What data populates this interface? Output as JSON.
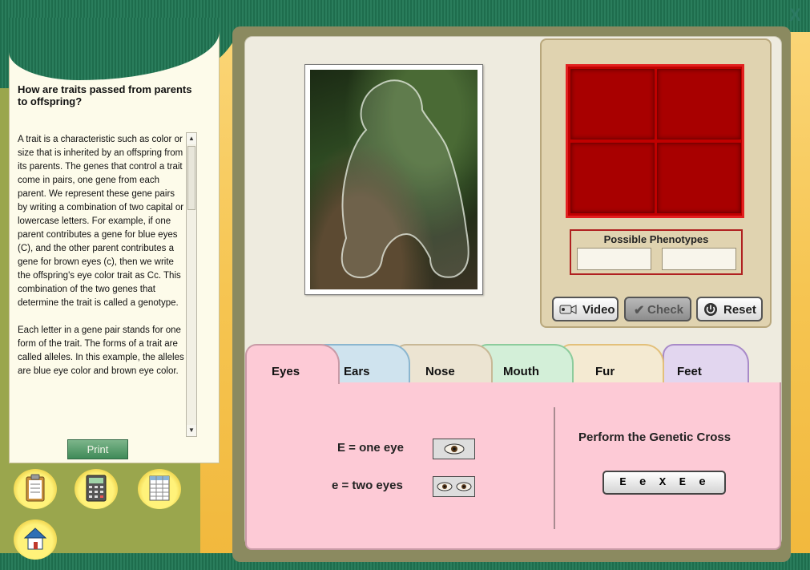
{
  "window": {
    "close_label": "X"
  },
  "sidebar": {
    "title": "How are traits passed from parents to offspring?",
    "paragraphs": [
      "A trait is a characteristic such as color or size that is inherited by an offspring from its parents. The genes that control a trait come in pairs, one gene from each parent. We represent these gene pairs by writing a combination of two capital or lowercase letters. For example, if one parent contributes a gene for blue eyes (C), and the other parent contributes a gene for brown eyes (c), then we write the offspring's eye color trait as Cc. This combination of the two genes that determine the trait is called a genotype.",
      "Each letter in a gene pair stands for one form of the trait. The forms of a trait are called alleles. In this example, the alleles are blue eye color and brown eye color."
    ],
    "print_label": "Print",
    "scroll_up": "▲",
    "scroll_down": "▼"
  },
  "tools": [
    {
      "name": "clipboard-icon"
    },
    {
      "name": "calculator-icon"
    },
    {
      "name": "spreadsheet-icon"
    },
    {
      "name": "home-icon"
    }
  ],
  "phenotypes": {
    "title": "Possible Phenotypes"
  },
  "controls": {
    "video_label": "Video",
    "check_label": "Check",
    "reset_label": "Reset"
  },
  "tabs": [
    {
      "label": "Eyes",
      "color": "#fdcad6",
      "border": "#c89aa6",
      "active": true
    },
    {
      "label": "Ears",
      "color": "#cfe3ee",
      "border": "#8bb6cf"
    },
    {
      "label": "Nose",
      "color": "#ece4d2",
      "border": "#c8b896"
    },
    {
      "label": "Mouth",
      "color": "#d3efd8",
      "border": "#8ccc9c"
    },
    {
      "label": "Fur",
      "color": "#f4ead2",
      "border": "#e3c07a"
    },
    {
      "label": "Feet",
      "color": "#e2d6ef",
      "border": "#a88ac8"
    }
  ],
  "traits": {
    "allele_dominant": "E = one eye",
    "allele_recessive": "e = two eyes",
    "cross_title": "Perform the Genetic Cross",
    "cross_label": "E e X E e"
  },
  "colors": {
    "punnett_fill": "#a80000",
    "content_bg": "#fdcad6",
    "accent_green": "#1e6d4d"
  }
}
